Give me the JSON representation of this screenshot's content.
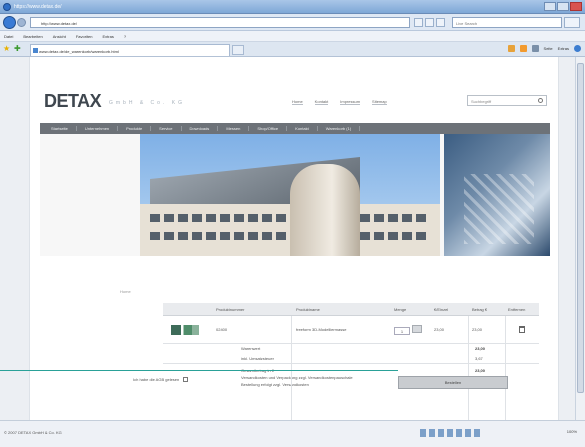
{
  "browser": {
    "title": "https://www.detax.de/",
    "url": "http://www.detax.de/",
    "search_placeholder": "Live Search",
    "menu": [
      "Datei",
      "Bearbeiten",
      "Ansicht",
      "Favoriten",
      "Extras",
      "?"
    ],
    "tab_title": "www.detax.de/de_warenkorb/warenkorb.html",
    "commands": [
      "Seite",
      "Extras"
    ]
  },
  "site": {
    "logo": "DETAX",
    "logo_sub": "GmbH & Co. KG",
    "top_links": [
      "Home",
      "Kontakt",
      "Impressum",
      "Sitemap"
    ],
    "search_placeholder": "Suchbegriff",
    "nav": [
      "Startseite",
      "Unternehmen",
      "Produkte",
      "Service",
      "Downloads",
      "Messen",
      "Shop/Office",
      "Kontakt",
      "Warenkorb (1)"
    ],
    "breadcrumb": "Home"
  },
  "cart": {
    "headers": [
      "",
      "Produktnummer",
      "Produktname",
      "Menge",
      "€/Einzel",
      "Betrag €",
      "Entfernen"
    ],
    "item": {
      "number": "02400",
      "name": "freeform 3D-Modelliermasse",
      "qty": "1",
      "unit_price": "23,00",
      "total": "23,00"
    },
    "subtotal_label": "Warenwert",
    "subtotal_value": "23,00",
    "vat_label": "inkl. Umsatzsteuer",
    "vat_value": "3,67",
    "shipping_lines": [
      "Gesamtbetrag in €",
      "Versandkosten und Verpackung zzgl. Versandkostenpauschale",
      "Bestellung erfolgt zzgl. Versandkosten"
    ],
    "shipping_value": "23,00",
    "terms_label": "Ich habe die AGB gelesen",
    "checkout_label": "Bestellen"
  },
  "status": {
    "text": "© 2007 DETAX GmbH & Co. KG",
    "zoom": "100%"
  }
}
